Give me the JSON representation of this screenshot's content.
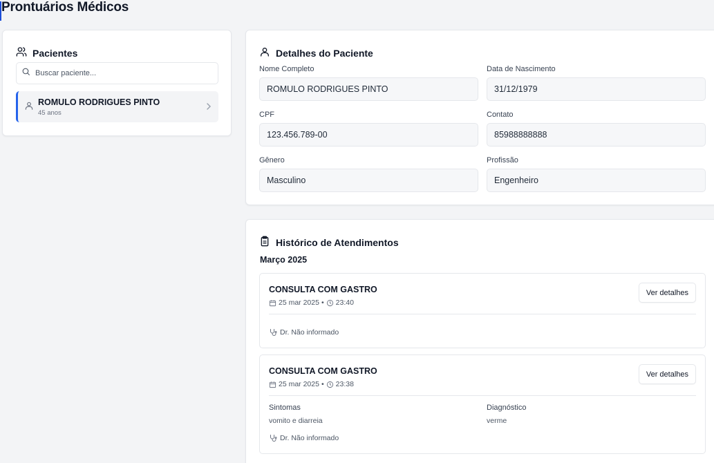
{
  "page_title": "Prontuários Médicos",
  "patients_panel": {
    "title": "Pacientes",
    "search_placeholder": "Buscar paciente...",
    "items": [
      {
        "name": "ROMULO RODRIGUES PINTO",
        "age": "45 anos"
      }
    ]
  },
  "details": {
    "title": "Detalhes do Paciente",
    "fields": {
      "name": {
        "label": "Nome Completo",
        "value": "ROMULO RODRIGUES PINTO"
      },
      "birth": {
        "label": "Data de Nascimento",
        "value": "31/12/1979"
      },
      "cpf": {
        "label": "CPF",
        "value": "123.456.789-00"
      },
      "contact": {
        "label": "Contato",
        "value": "85988888888"
      },
      "gender": {
        "label": "Gênero",
        "value": "Masculino"
      },
      "profession": {
        "label": "Profissão",
        "value": "Engenheiro"
      }
    }
  },
  "history": {
    "title": "Histórico de Atendimentos",
    "month": "Março 2025",
    "consultations": [
      {
        "title": "CONSULTA COM GASTRO",
        "date": "25 mar 2025",
        "separator": "•",
        "time": "23:40",
        "button": "Ver detalhes",
        "doctor": "Dr. Não informado"
      },
      {
        "title": "CONSULTA COM GASTRO",
        "date": "25 mar 2025",
        "separator": "•",
        "time": "23:38",
        "button": "Ver detalhes",
        "symptoms_label": "Sintomas",
        "symptoms": "vomito e diarreia",
        "diagnosis_label": "Diagnóstico",
        "diagnosis": "verme",
        "doctor": "Dr. Não informado"
      }
    ]
  },
  "colors": {
    "accent": "#2563eb",
    "background": "#f3f4f6",
    "card": "#ffffff",
    "border": "#e5e7eb"
  }
}
